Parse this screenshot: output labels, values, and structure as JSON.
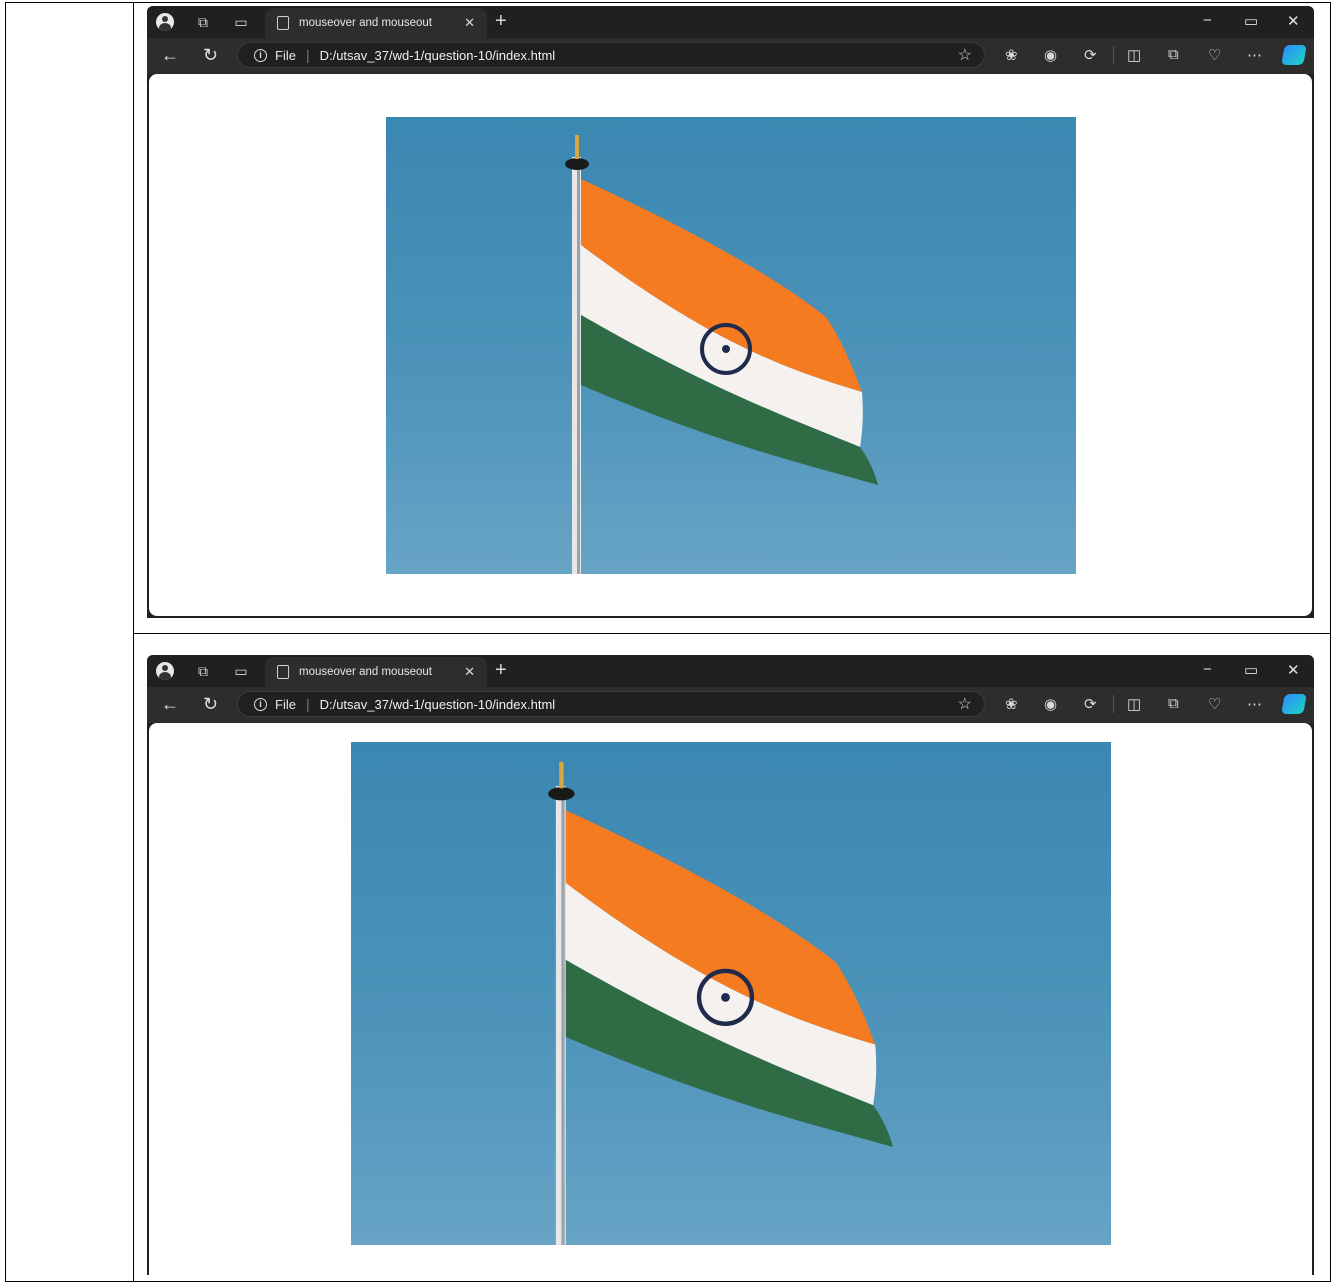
{
  "browser": {
    "tab_title": "mouseover and mouseout",
    "address": {
      "scheme_label": "File",
      "url": "D:/utsav_37/wd-1/question-10/index.html"
    },
    "window_controls": {
      "minimize": "−",
      "restore": "▭",
      "close": "✕"
    },
    "new_tab_glyph": "+",
    "tab_close_glyph": "✕"
  },
  "page": {
    "image": {
      "subject": "flag-image",
      "colors": {
        "saffron": "#f47b20",
        "white": "#f4f1ee",
        "green": "#2f6b45",
        "chakra": "#1f2a4d",
        "sky": "#4d93ba"
      }
    }
  },
  "icons": [
    "profile-icon",
    "collections-icon",
    "tab-actions-icon",
    "page-icon",
    "back-icon",
    "reload-icon",
    "info-icon",
    "favorite-star-icon",
    "extensions-icon",
    "browser-essentials-icon",
    "performance-icon",
    "split-screen-icon",
    "favorites-icon",
    "health-icon",
    "more-icon",
    "copilot-icon"
  ]
}
